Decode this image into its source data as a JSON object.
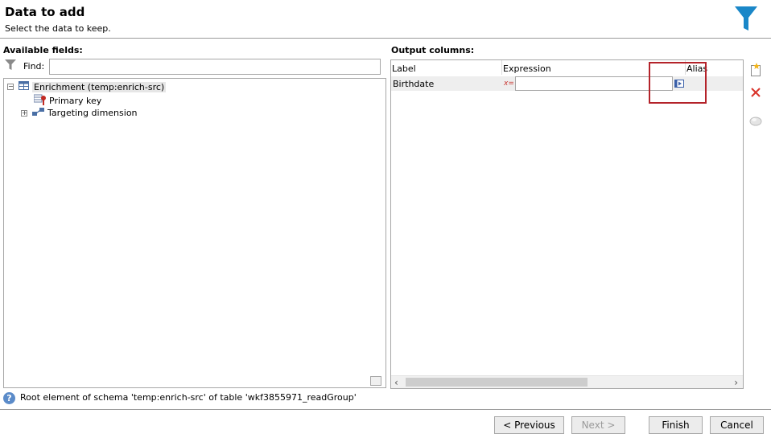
{
  "header": {
    "title": "Data to add",
    "subtitle": "Select the data to keep."
  },
  "available": {
    "label": "Available fields:",
    "find_label": "Find:",
    "find_value": "",
    "tree": [
      {
        "label": "Enrichment (temp:enrich-src)",
        "expander": "−",
        "icon": "table-icon"
      },
      {
        "label": "Primary key",
        "icon": "primary-key-icon"
      },
      {
        "label": "Targeting dimension",
        "expander": "+",
        "icon": "link-icon"
      }
    ]
  },
  "output": {
    "label": "Output columns:",
    "columns": [
      "Label",
      "Expression",
      "Alias"
    ],
    "rows": [
      {
        "label": "Birthdate",
        "expression_icon": "x=",
        "expression": "",
        "alias": ""
      }
    ]
  },
  "status": {
    "text": "Root element of schema 'temp:enrich-src' of table 'wkf3855971_readGroup'"
  },
  "buttons": {
    "previous_label": "< Previous",
    "next_label": "Next >",
    "finish_label": "Finish",
    "cancel_label": "Cancel"
  },
  "colors": {
    "accent": "#1a87c8",
    "highlight": "#b4232a"
  }
}
